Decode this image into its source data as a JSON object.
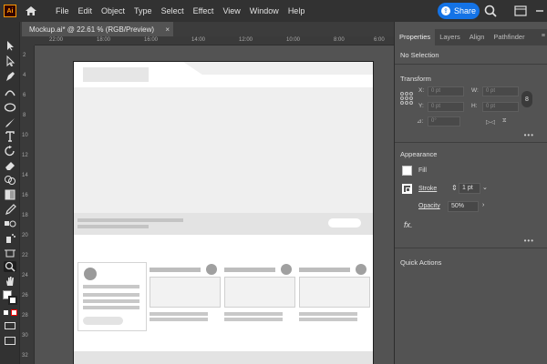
{
  "app": {
    "logo_text": "Ai"
  },
  "menu": {
    "items": [
      "File",
      "Edit",
      "Object",
      "Type",
      "Select",
      "Effect",
      "View",
      "Window",
      "Help"
    ]
  },
  "share": {
    "label": "Share"
  },
  "document": {
    "tab_title": "Mockup.ai* @ 22.61 % (RGB/Preview)",
    "close_glyph": "×"
  },
  "rulers": {
    "horizontal": [
      "22:00",
      "18:00",
      "16:00",
      "14:00",
      "12:00",
      "10:00",
      "8:00",
      "6:00"
    ],
    "vertical": [
      "2",
      "4",
      "6",
      "8",
      "10",
      "12",
      "14",
      "16",
      "18",
      "20",
      "22",
      "24",
      "26",
      "28",
      "30",
      "32"
    ]
  },
  "panel": {
    "tabs": [
      "Properties",
      "Layers",
      "Align",
      "Pathfinder"
    ],
    "active_tab": "Properties",
    "menu_glyph": "≡",
    "selection_status": "No Selection",
    "transform": {
      "title": "Transform",
      "x_label": "X:",
      "x_value": "0 pt",
      "y_label": "Y:",
      "y_value": "0 pt",
      "w_label": "W:",
      "w_value": "0 pt",
      "h_label": "H:",
      "h_value": "0 pt",
      "angle_label": "⊿:",
      "angle_value": "0°",
      "link_glyph": "8",
      "flip_h_glyph": "▷◁",
      "flip_v_glyph": "⧖",
      "more_glyph": "•••"
    },
    "appearance": {
      "title": "Appearance",
      "fill_label": "Fill",
      "stroke_label": "Stroke",
      "stroke_value": "1 pt",
      "opacity_label": "Opacity",
      "opacity_value": "50%",
      "fx_label": "fx.",
      "more_glyph": "•••"
    },
    "quick_actions": {
      "title": "Quick Actions"
    }
  },
  "icons": [
    "ai-logo",
    "home-icon",
    "search-icon",
    "window-arrange-icon",
    "minimize-icon",
    "selection-tool-icon",
    "direct-selection-icon",
    "pen-tool-icon",
    "curvature-icon",
    "ellipse-tool-icon",
    "paintbrush-icon",
    "type-tool-icon",
    "rotate-icon",
    "eraser-icon",
    "shape-builder-icon",
    "gradient-icon",
    "eyedropper-icon",
    "blend-icon",
    "symbol-sprayer-icon",
    "artboard-tool-icon",
    "hand-tool-icon",
    "zoom-tool-icon"
  ]
}
